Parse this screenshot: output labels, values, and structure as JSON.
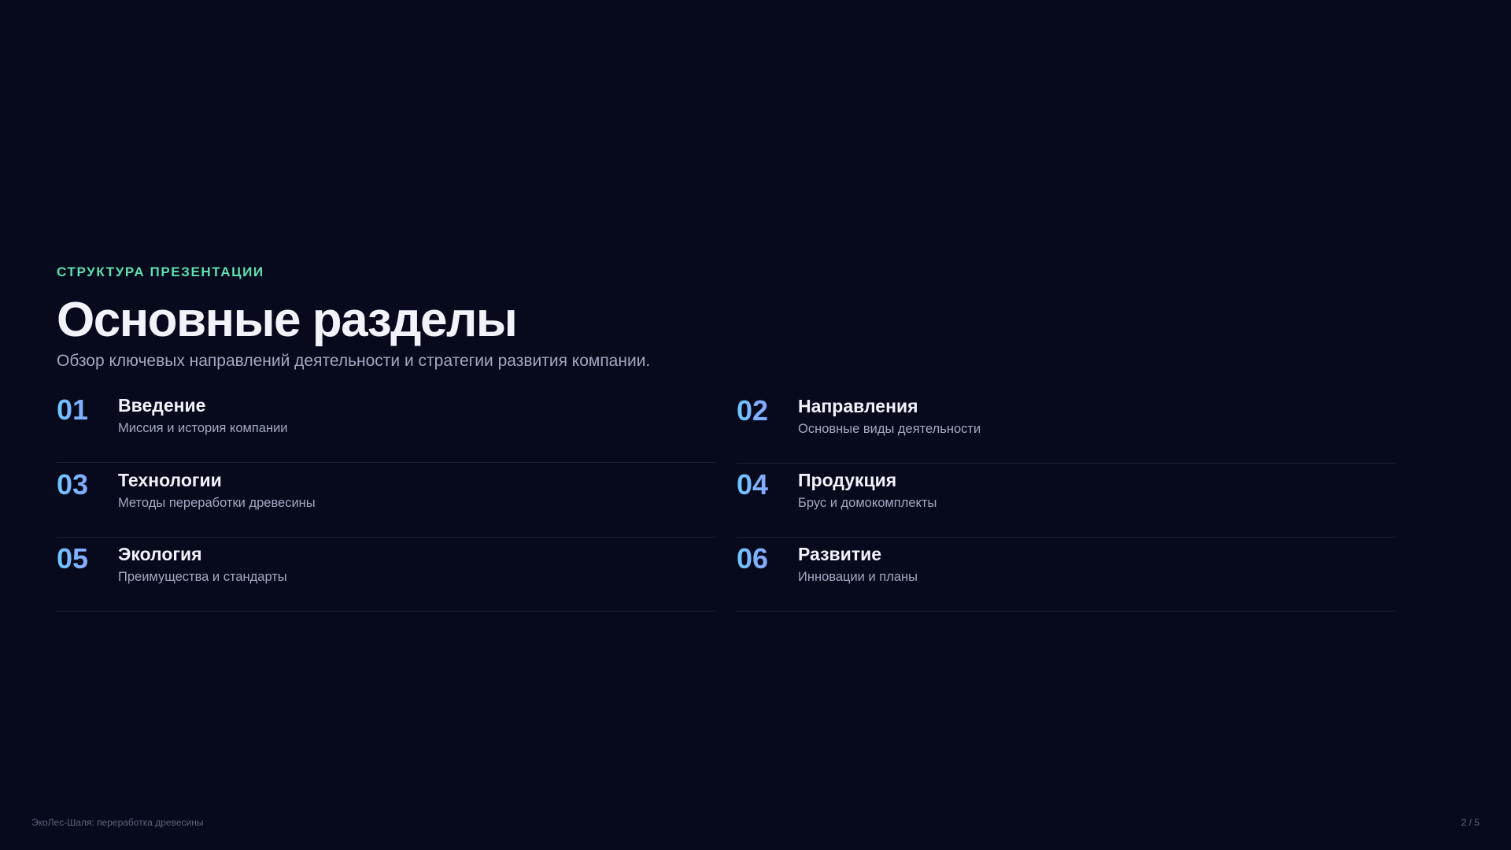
{
  "header": {
    "eyebrow": "СТРУКТУРА ПРЕЗЕНТАЦИИ",
    "title": "Основные разделы",
    "subtitle": "Обзор ключевых направлений деятельности и стратегии развития компании."
  },
  "sections": [
    {
      "number": "01",
      "title": "Введение",
      "description": "Миссия и история компании"
    },
    {
      "number": "02",
      "title": "Направления",
      "description": "Основные виды деятельности"
    },
    {
      "number": "03",
      "title": "Технологии",
      "description": "Методы переработки древесины"
    },
    {
      "number": "04",
      "title": "Продукция",
      "description": "Брус и домокомплекты"
    },
    {
      "number": "05",
      "title": "Экология",
      "description": "Преимущества и стандарты"
    },
    {
      "number": "06",
      "title": "Развитие",
      "description": "Инновации и планы"
    }
  ],
  "footer": {
    "left": "ЭкоЛес-Шаля: переработка древесины",
    "right": "2 / 5"
  },
  "colors": {
    "background": "#060a1c",
    "accent": "#5ee0b0",
    "number_gradient_start": "#6ec6ff",
    "number_gradient_end": "#9d8cff",
    "text_primary": "#f1f3fb",
    "text_secondary": "#a3a9c2"
  }
}
